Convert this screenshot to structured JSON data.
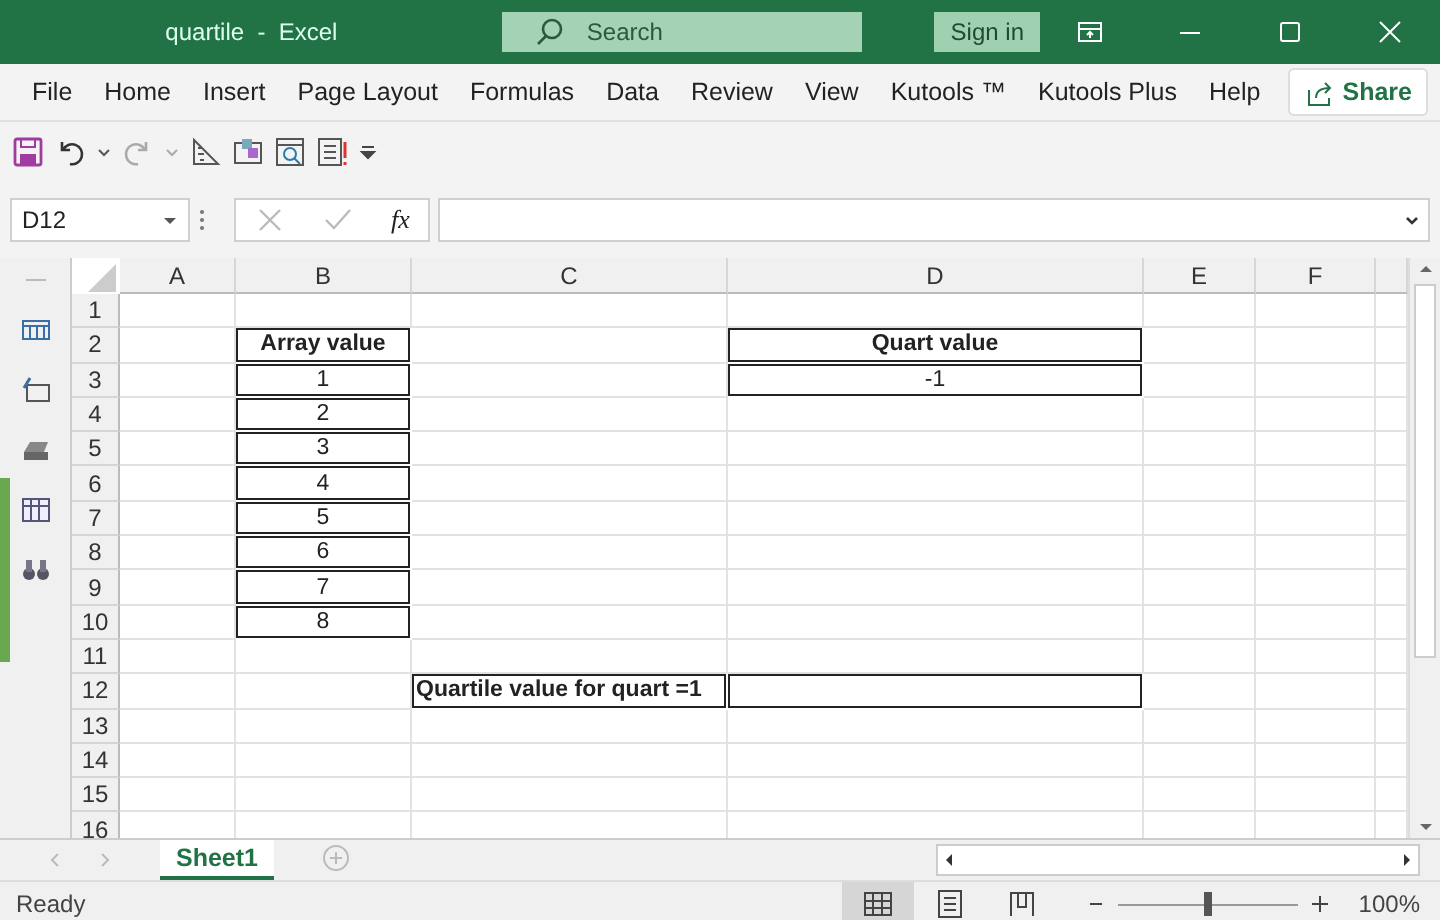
{
  "window": {
    "title": "quartile  -  Excel",
    "search_placeholder": "Search",
    "sign_in": "Sign in"
  },
  "menu": {
    "items": [
      "File",
      "Home",
      "Insert",
      "Page Layout",
      "Formulas",
      "Data",
      "Review",
      "View",
      "Kutools ™",
      "Kutools Plus",
      "Help"
    ],
    "share": "Share"
  },
  "formula_bar": {
    "name_box": "D12",
    "function_label": "fx"
  },
  "sheet": {
    "columns": [
      "A",
      "B",
      "C",
      "D",
      "E",
      "F"
    ],
    "rows": [
      {
        "label": "1",
        "cells": [
          {},
          {},
          {},
          {},
          {},
          {}
        ]
      },
      {
        "label": "2",
        "cells": [
          {},
          {
            "text": "Array value",
            "bold": true,
            "bordered": true,
            "centered": true
          },
          {},
          {
            "text": "Quart value",
            "bold": true,
            "bordered": true,
            "centered": true
          },
          {},
          {}
        ]
      },
      {
        "label": "3",
        "cells": [
          {},
          {
            "text": "1",
            "bordered": true,
            "centered": true
          },
          {},
          {
            "text": "-1",
            "bordered": true,
            "centered": true
          },
          {},
          {}
        ]
      },
      {
        "label": "4",
        "cells": [
          {},
          {
            "text": "2",
            "bordered": true,
            "centered": true
          },
          {},
          {},
          {},
          {}
        ]
      },
      {
        "label": "5",
        "cells": [
          {},
          {
            "text": "3",
            "bordered": true,
            "centered": true
          },
          {},
          {},
          {},
          {}
        ]
      },
      {
        "label": "6",
        "cells": [
          {},
          {
            "text": "4",
            "bordered": true,
            "centered": true
          },
          {},
          {},
          {},
          {}
        ]
      },
      {
        "label": "7",
        "cells": [
          {},
          {
            "text": "5",
            "bordered": true,
            "centered": true
          },
          {},
          {},
          {},
          {}
        ]
      },
      {
        "label": "8",
        "cells": [
          {},
          {
            "text": "6",
            "bordered": true,
            "centered": true
          },
          {},
          {},
          {},
          {}
        ]
      },
      {
        "label": "9",
        "cells": [
          {},
          {
            "text": "7",
            "bordered": true,
            "centered": true
          },
          {},
          {},
          {},
          {}
        ]
      },
      {
        "label": "10",
        "cells": [
          {},
          {
            "text": "8",
            "bordered": true,
            "centered": true
          },
          {},
          {},
          {},
          {}
        ]
      },
      {
        "label": "11",
        "cells": [
          {},
          {},
          {},
          {},
          {},
          {}
        ]
      },
      {
        "label": "12",
        "cells": [
          {},
          {},
          {
            "text": "Quartile value for quart =1",
            "bold": true,
            "bordered": true,
            "centered": false
          },
          {
            "bordered": true
          },
          {},
          {}
        ]
      },
      {
        "label": "13",
        "cells": [
          {},
          {},
          {},
          {},
          {},
          {}
        ]
      },
      {
        "label": "14",
        "cells": [
          {},
          {},
          {},
          {},
          {},
          {}
        ]
      },
      {
        "label": "15",
        "cells": [
          {},
          {},
          {},
          {},
          {},
          {}
        ]
      },
      {
        "label": "16",
        "cells": [
          {},
          {},
          {},
          {},
          {},
          {}
        ]
      }
    ]
  },
  "sheet_tabs": [
    {
      "label": "Sheet1",
      "selected": true
    }
  ],
  "status_bar": {
    "status": "Ready",
    "views": [
      {
        "kind": "normal",
        "selected": true
      },
      {
        "kind": "page-layout",
        "selected": false
      },
      {
        "kind": "page-break",
        "selected": false
      }
    ],
    "zoom": {
      "level": 0.5,
      "reading": "100%"
    }
  }
}
